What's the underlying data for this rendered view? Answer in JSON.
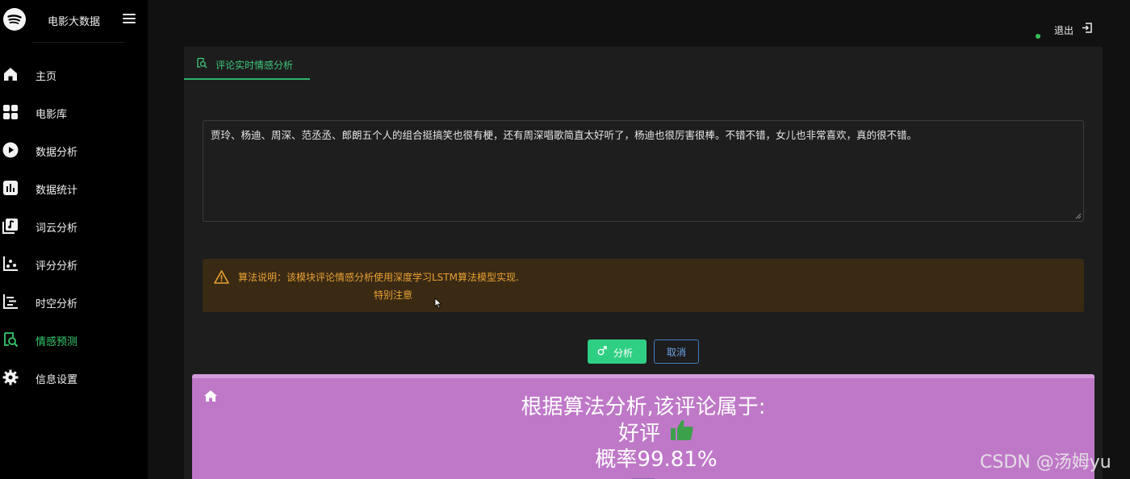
{
  "app": {
    "title": "电影大数据",
    "logo_icon": "spotify-logo-icon"
  },
  "sidebar": {
    "items": [
      {
        "label": "主页",
        "icon": "home-icon",
        "active": false
      },
      {
        "label": "电影库",
        "icon": "grid-icon",
        "active": false
      },
      {
        "label": "数据分析",
        "icon": "play-circle-icon",
        "active": false
      },
      {
        "label": "数据统计",
        "icon": "bar-chart-icon",
        "active": false
      },
      {
        "label": "词云分析",
        "icon": "book-icon",
        "active": false
      },
      {
        "label": "评分分析",
        "icon": "scatter-icon",
        "active": false
      },
      {
        "label": "时空分析",
        "icon": "timeline-icon",
        "active": false
      },
      {
        "label": "情感预测",
        "icon": "search-doc-icon",
        "active": true
      },
      {
        "label": "信息设置",
        "icon": "gear-icon",
        "active": false
      }
    ]
  },
  "header": {
    "logout_label": "退出",
    "logout_icon": "sign-out-icon",
    "status_color": "#36c15b"
  },
  "main": {
    "tab_label": "评论实时情感分析",
    "tab_icon": "search-doc-icon",
    "comment": "贾玲、杨迪、周深、范丞丞、郎朗五个人的组合挺搞笑也很有梗，还有周深唱歌简直太好听了，杨迪也很厉害很棒。不错不错，女儿也非常喜欢，真的很不错。",
    "alert": {
      "text": "算法说明：该模块评论情感分析使用深度学习LSTM算法模型实现.",
      "subtext": "特别注意",
      "icon": "warning-icon",
      "color": "#e8a033"
    },
    "analyze_label": "分析",
    "analyze_icon": "male-icon",
    "cancel_label": "取消"
  },
  "result": {
    "line1": "根据算法分析,该评论属于:",
    "verdict": "好评",
    "verdict_icon": "thumbs-up-icon",
    "probability": "概率99.81%",
    "home_icon": "home-icon",
    "background": "#bf78c8"
  },
  "watermark": "CSDN @汤姆yu",
  "colors": {
    "accent": "#35c96f",
    "analyze_button": "#2fcf83",
    "cancel_border": "#3f7fc4"
  }
}
